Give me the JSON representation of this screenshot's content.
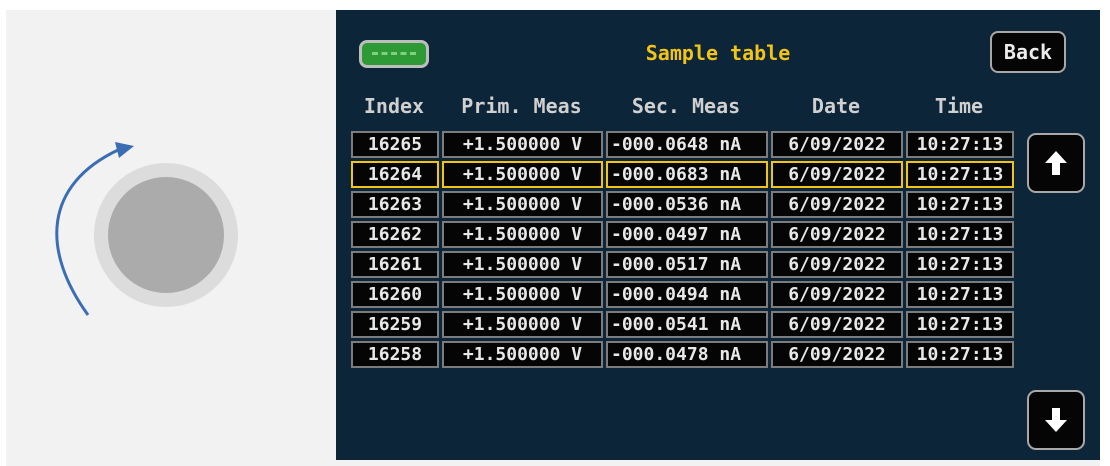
{
  "screen": {
    "title": "Sample table",
    "back_label": "Back",
    "usb_icon": "usb-drive-icon",
    "scroll_up_icon": "arrow-up-icon",
    "scroll_down_icon": "arrow-down-icon",
    "columns": [
      "Index",
      "Prim. Meas",
      "Sec. Meas",
      "Date",
      "Time"
    ],
    "selected_index": "16264",
    "rows": [
      {
        "index": "16265",
        "prim": "+1.500000 V",
        "sec": "-000.0648 nA",
        "date": "6/09/2022",
        "time": "10:27:13"
      },
      {
        "index": "16264",
        "prim": "+1.500000 V",
        "sec": "-000.0683 nA",
        "date": "6/09/2022",
        "time": "10:27:13"
      },
      {
        "index": "16263",
        "prim": "+1.500000 V",
        "sec": "-000.0536 nA",
        "date": "6/09/2022",
        "time": "10:27:13"
      },
      {
        "index": "16262",
        "prim": "+1.500000 V",
        "sec": "-000.0497 nA",
        "date": "6/09/2022",
        "time": "10:27:13"
      },
      {
        "index": "16261",
        "prim": "+1.500000 V",
        "sec": "-000.0517 nA",
        "date": "6/09/2022",
        "time": "10:27:13"
      },
      {
        "index": "16260",
        "prim": "+1.500000 V",
        "sec": "-000.0494 nA",
        "date": "6/09/2022",
        "time": "10:27:13"
      },
      {
        "index": "16259",
        "prim": "+1.500000 V",
        "sec": "-000.0541 nA",
        "date": "6/09/2022",
        "time": "10:27:13"
      },
      {
        "index": "16258",
        "prim": "+1.500000 V",
        "sec": "-000.0478 nA",
        "date": "6/09/2022",
        "time": "10:27:13"
      }
    ]
  },
  "knob": {
    "icon": "rotary-knob-icon",
    "rotation_arrow": "clockwise-arrow-icon"
  },
  "colors": {
    "screen_bg": "#0c2538",
    "title": "#f2c418",
    "selection": "#f2c418",
    "usb": "#2d9a36",
    "arrow": "#3b6db5"
  }
}
